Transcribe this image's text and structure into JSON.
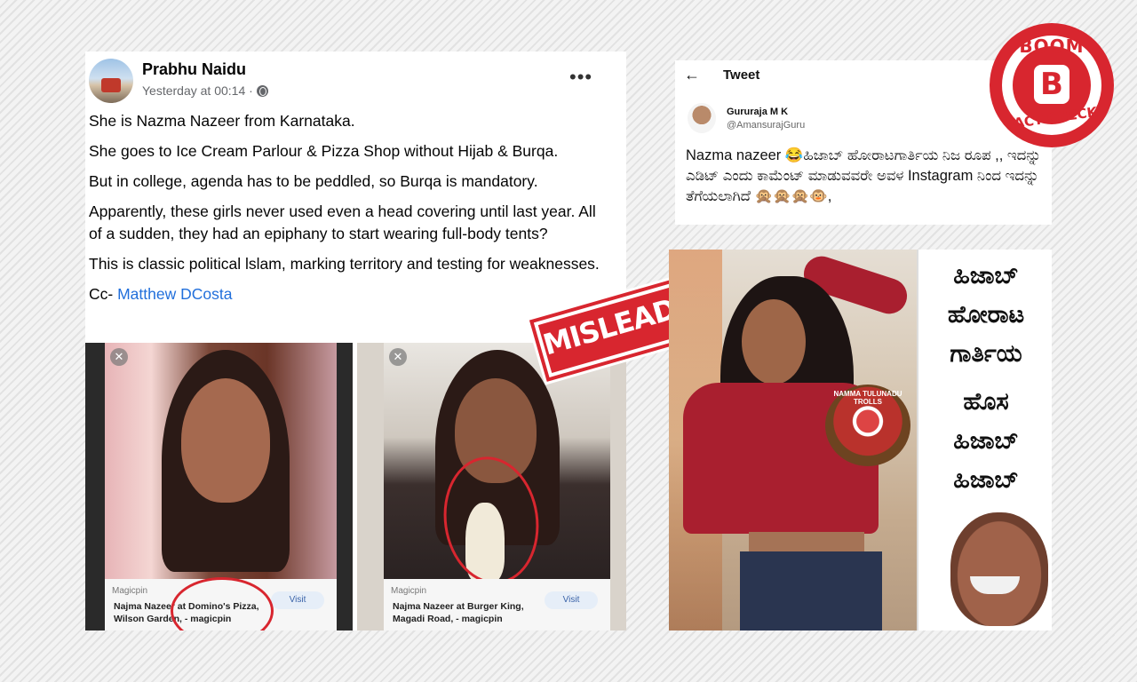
{
  "facebook_post": {
    "author": "Prabhu Naidu",
    "timestamp": "Yesterday at 00:14 ·",
    "more_icon": "more-horizontal-icon",
    "paragraphs": [
      "She is Nazma Nazeer from Karnataka.",
      "She goes to Ice Cream Parlour & Pizza Shop without Hijab & Burqa.",
      "But in college, agenda has to be peddled, so Burqa is mandatory.",
      "Apparently, these girls never used even a head covering until last year. All of a sudden, they had an epiphany to start wearing full-body tents?",
      "This is classic political lslam, marking territory and testing for weaknesses."
    ],
    "cc_prefix": "Cc-",
    "cc_link": "Matthew DCosta",
    "images": [
      {
        "source": "Magicpin",
        "caption": "Najma Nazeer at Domino's Pizza, Wilson Garden, - magicpin",
        "button": "Visit"
      },
      {
        "source": "Magicpin",
        "caption": "Najma Nazeer at Burger King, Magadi Road, - magicpin",
        "button": "Visit"
      }
    ]
  },
  "stamp": {
    "label": "MISLEADING",
    "color": "#d8262f"
  },
  "tweet": {
    "header": "Tweet",
    "author_name": "Gururaja M K",
    "author_handle": "@AmansurajGuru",
    "text": "Nazma nazeer 😂ಹಿಜಾಬ್ ಹೋರಾಟಗಾರ್ತಿಯ ನಿಜ ರೂಪ ,, ಇದನ್ನು ಎಡಿಟ್ ಎಂದು ಕಾಮೆಂಟ್ ಮಾಡುವವರೇ ಅವಳ Instagram ನಿಂದ ಇದನ್ನು ತೆಗೆಯಲಾಗಿದೆ 🙊🙊🙊🐵,"
  },
  "meme": {
    "watermark": "NAMMA TULUNADU TROLLS",
    "lines_top": [
      "ಹಿಜಾಬ್",
      "ಹೋರಾಟ",
      "ಗಾರ್ತಿಯ"
    ],
    "lines_bottom": [
      "ಹೊಸ",
      "ಹಿಜಾಬ್",
      "ಹಿಜಾಬ್"
    ]
  },
  "brand": {
    "top": "BOOM",
    "letter": "B",
    "bottom": "FACT CHECK",
    "color": "#d8262f"
  }
}
